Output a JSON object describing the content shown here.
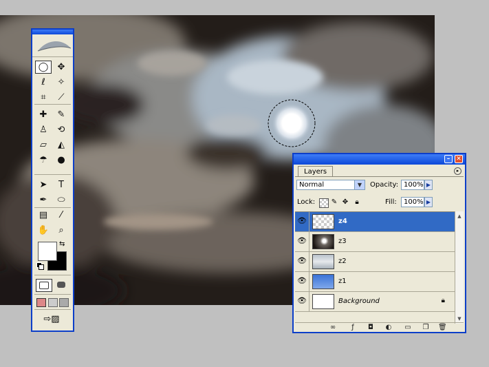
{
  "canvas": {
    "description_icon": "moon-clouds-image"
  },
  "toolbox": {
    "logo_icon": "feather-logo-icon",
    "tools": [
      {
        "id": "marquee",
        "icon": "elliptical-marquee-icon",
        "glyph": "◯",
        "active": true
      },
      {
        "id": "move",
        "icon": "move-icon",
        "glyph": "✥"
      },
      {
        "id": "lasso",
        "icon": "lasso-icon",
        "glyph": "ℓ"
      },
      {
        "id": "magic-wand",
        "icon": "magic-wand-icon",
        "glyph": "✧"
      },
      {
        "id": "crop",
        "icon": "crop-icon",
        "glyph": "⌗"
      },
      {
        "id": "slice",
        "icon": "slice-icon",
        "glyph": "⟋"
      },
      {
        "id": "healing",
        "icon": "healing-brush-icon",
        "glyph": "✚"
      },
      {
        "id": "brush",
        "icon": "brush-icon",
        "glyph": "✎"
      },
      {
        "id": "stamp",
        "icon": "clone-stamp-icon",
        "glyph": "♙"
      },
      {
        "id": "history-brush",
        "icon": "history-brush-icon",
        "glyph": "⟲"
      },
      {
        "id": "eraser",
        "icon": "eraser-icon",
        "glyph": "▱"
      },
      {
        "id": "bucket",
        "icon": "paint-bucket-icon",
        "glyph": "◭"
      },
      {
        "id": "blur",
        "icon": "blur-icon",
        "glyph": "☂"
      },
      {
        "id": "dodge",
        "icon": "dodge-icon",
        "glyph": "●"
      },
      {
        "id": "path-select",
        "icon": "path-selection-icon",
        "glyph": "➤"
      },
      {
        "id": "type",
        "icon": "type-icon",
        "glyph": "T"
      },
      {
        "id": "pen",
        "icon": "pen-icon",
        "glyph": "✒"
      },
      {
        "id": "shape",
        "icon": "ellipse-shape-icon",
        "glyph": "⬭"
      },
      {
        "id": "notes",
        "icon": "notes-icon",
        "glyph": "▤"
      },
      {
        "id": "eyedropper",
        "icon": "eyedropper-icon",
        "glyph": "⁄"
      },
      {
        "id": "hand",
        "icon": "hand-icon",
        "glyph": "✋"
      },
      {
        "id": "zoom",
        "icon": "zoom-icon",
        "glyph": "⌕"
      }
    ],
    "colors": {
      "foreground": "#ffffff",
      "background": "#000000"
    }
  },
  "layers_panel": {
    "tab_label": "Layers",
    "blend_mode": "Normal",
    "opacity_label": "Opacity:",
    "opacity_value": "100%",
    "lock_label": "Lock:",
    "fill_label": "Fill:",
    "fill_value": "100%",
    "layers": [
      {
        "name": "z4",
        "selected": true,
        "thumb": "transparent"
      },
      {
        "name": "z3",
        "selected": false,
        "thumb": "dark"
      },
      {
        "name": "z2",
        "selected": false,
        "thumb": "light"
      },
      {
        "name": "z1",
        "selected": false,
        "thumb": "blue"
      },
      {
        "name": "Background",
        "selected": false,
        "thumb": "white",
        "locked": true
      }
    ]
  }
}
